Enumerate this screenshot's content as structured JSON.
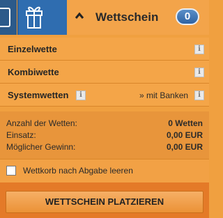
{
  "header": {
    "title": "Wettschein",
    "count": "0",
    "icons": [
      "phone-icon",
      "gift-icon",
      "caret-up-icon"
    ]
  },
  "bet_types": [
    {
      "label": "Einzelwette"
    },
    {
      "label": "Kombiwette"
    },
    {
      "label": "Systemwetten",
      "link": "» mit Banken"
    }
  ],
  "info_glyph": "i",
  "summary": {
    "num_bets_label": "Anzahl der Wetten:",
    "num_bets_value": "0 Wetten",
    "stake_label": "Einsatz:",
    "stake_value": "0,00 EUR",
    "win_label": "Möglicher Gewinn:",
    "win_value": "0,00 EUR"
  },
  "options": {
    "clear_after_submit_label": "Wettkorb nach Abgabe leeren",
    "clear_after_submit_checked": false
  },
  "footer": {
    "place_button_label": "WETTSCHEIN PLATZIEREN"
  },
  "colors": {
    "accent_orange": "#f2a03f",
    "tab_blue": "#2f6db0",
    "badge_blue": "#2e63a3"
  }
}
